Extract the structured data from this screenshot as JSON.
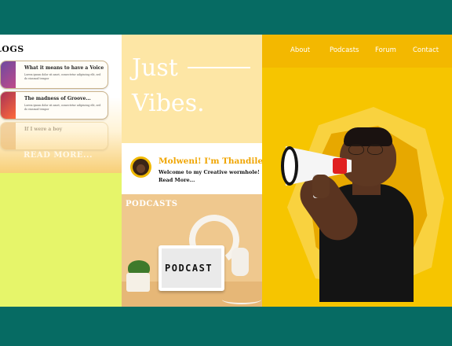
{
  "nav": {
    "about": "About",
    "podcasts": "Podcasts",
    "forum": "Forum",
    "contact": "Contact"
  },
  "hero": {
    "line1": "Just",
    "line2": "Vibes."
  },
  "blogs": {
    "title": "LOGS",
    "items": [
      {
        "title": "What it means to have a Voice",
        "desc": "Lorem ipsum dolor sit amet, consectetur adipiscing elit, sed do eiusmod tempor"
      },
      {
        "title": "The madness of Groove...",
        "desc": "Lorem ipsum dolor sit amet, consectetur adipiscing elit, sed do eiusmod tempor"
      },
      {
        "title": "If I were a boy"
      }
    ],
    "read_more": "READ MORE..."
  },
  "greeting": {
    "title": "Molweni! I'm Thandile",
    "subtitle": "Welcome to my Creative wormhole!",
    "link": "Read More..."
  },
  "podcasts": {
    "title": "PODCASTS",
    "lightbox_text": "PODCAST"
  },
  "colors": {
    "teal": "#066b63",
    "yellow": "#f6c500",
    "orange_title": "#f0a500",
    "lime": "#e6f56a"
  }
}
